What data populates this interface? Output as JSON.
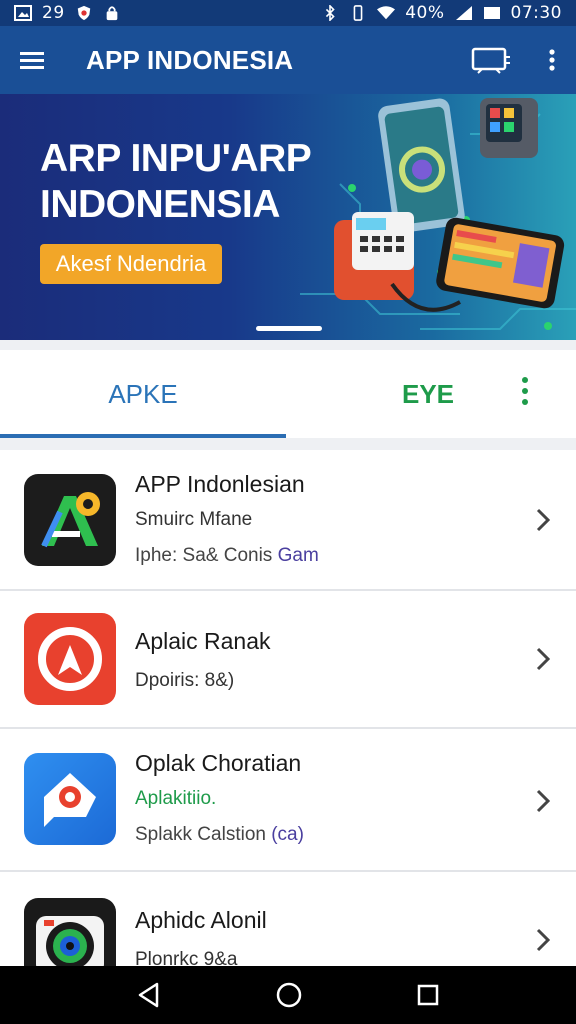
{
  "status_bar": {
    "left_text": "29",
    "battery": "40%",
    "time": "07:30",
    "icons": [
      "gallery-icon",
      "shield-icon",
      "lock-icon",
      "bluetooth-icon",
      "vibrate-icon",
      "wifi-icon",
      "signal-icon",
      "battery-icon"
    ]
  },
  "app_bar": {
    "title": "APP INDONESIA",
    "icons": [
      "menu-icon",
      "cast-icon",
      "more-vert-icon"
    ]
  },
  "banner": {
    "title_line1": "ARP INPU'ARP",
    "title_line2": "INDONENSIA",
    "cta_label": "Akesf Ndendria",
    "colors": {
      "cta": "#f2a628",
      "background_start": "#1b2c7a",
      "background_end": "#2aa0b8"
    }
  },
  "tabs": {
    "items": [
      {
        "label": "APKE",
        "selected": true
      },
      {
        "label": "EYE",
        "selected": false
      }
    ],
    "colors": {
      "selected": "#2b74b8",
      "eye": "#1e9b4a"
    }
  },
  "list": {
    "items": [
      {
        "title": "APP Indonlesian",
        "subtitle": "Smuirc Mfane",
        "meta_prefix": "Iphe: Sa& Conis ",
        "meta_accent": "Gam",
        "icon": "app-a-icon"
      },
      {
        "title": "Aplaic Ranak",
        "subtitle": "Dpoiris: 8&)",
        "meta_prefix": "",
        "meta_accent": "",
        "icon": "red-app-icon"
      },
      {
        "title": "Oplak Choratian",
        "subtitle": "Aplakitiio.",
        "meta_prefix": "Splakk Calstion ",
        "meta_accent": "(ca)",
        "icon": "location-chat-icon"
      },
      {
        "title": "Aphidc Alonil",
        "subtitle": "Plonrkc 9&a",
        "meta_prefix": "",
        "meta_accent": "",
        "icon": "camera-lens-icon"
      }
    ]
  },
  "nav_bar": {
    "icons": [
      "back-icon",
      "home-icon",
      "recents-icon"
    ]
  }
}
